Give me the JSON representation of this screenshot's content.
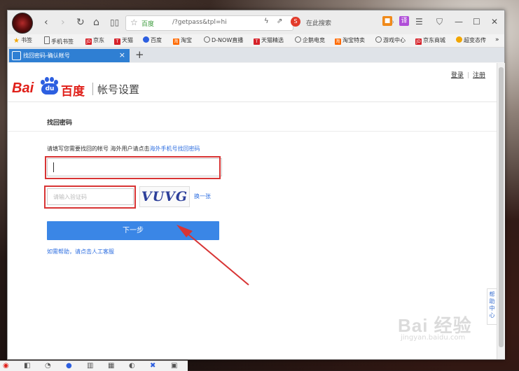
{
  "browser": {
    "address": {
      "site_label": "百度",
      "url": "/?getpass&tpl=hi"
    },
    "search_box": {
      "engine_badge": "S",
      "placeholder": "在此搜索"
    },
    "translate_badge": "译"
  },
  "bookmarks": [
    {
      "label": "书签",
      "icon": "star-icon",
      "color": "#f2a600"
    },
    {
      "label": "手机书签",
      "icon": "phone-icon",
      "color": "#666666"
    },
    {
      "label": "京东",
      "icon": "jd-icon",
      "badge": "JD",
      "color": "#d6222a"
    },
    {
      "label": "天猫",
      "icon": "tmall-icon",
      "badge": "T",
      "color": "#d6222a"
    },
    {
      "label": "百度",
      "icon": "baidu-icon",
      "color": "#2d5fe0"
    },
    {
      "label": "淘宝",
      "icon": "taobao-icon",
      "badge": "淘",
      "color": "#ff6a00"
    },
    {
      "label": "D-NOW直播",
      "icon": "globe-icon",
      "color": "#666666"
    },
    {
      "label": "天猫精选",
      "icon": "tmall-icon",
      "badge": "T",
      "color": "#d6222a"
    },
    {
      "label": "企鹅电竞",
      "icon": "globe-icon",
      "color": "#666666"
    },
    {
      "label": "淘宝特卖",
      "icon": "taobao-icon",
      "badge": "淘",
      "color": "#ff6a00"
    },
    {
      "label": "游戏中心",
      "icon": "globe-icon",
      "color": "#666666"
    },
    {
      "label": "京东商城",
      "icon": "jd-icon",
      "badge": "JD",
      "color": "#d6222a"
    },
    {
      "label": "超变态传",
      "icon": "game-icon",
      "color": "#f2a600"
    }
  ],
  "bookmarks_overflow": "»",
  "tab": {
    "title": "找回密码-确认帐号",
    "close": "×"
  },
  "new_tab": "+",
  "page": {
    "top_links": {
      "login": "登录",
      "register": "注册"
    },
    "brand": {
      "bai": "Bai",
      "du": "du",
      "cn": "百度",
      "product": "帐号设置"
    },
    "section_title": "找回密码",
    "hint_text": "请填写您需要找回的帐号 海外用户请点击",
    "hint_link": "海外手机号找回密码",
    "captcha_placeholder": "请输入验证码",
    "captcha_text": "VUVG",
    "refresh_label": "换一张",
    "next_button": "下一步",
    "help_link": "如需帮助，请点击人工客服",
    "side_help": [
      "帮",
      "助",
      "中",
      "心"
    ]
  },
  "watermark": {
    "line1": "Bai 经验",
    "line2": "jingyan.baidu.com"
  },
  "colors": {
    "accent": "#3a86e6",
    "annotation_red": "#d83434",
    "tab_blue": "#2f7fd3",
    "brand_red": "#e0201a",
    "brand_blue": "#2d5fe0"
  }
}
